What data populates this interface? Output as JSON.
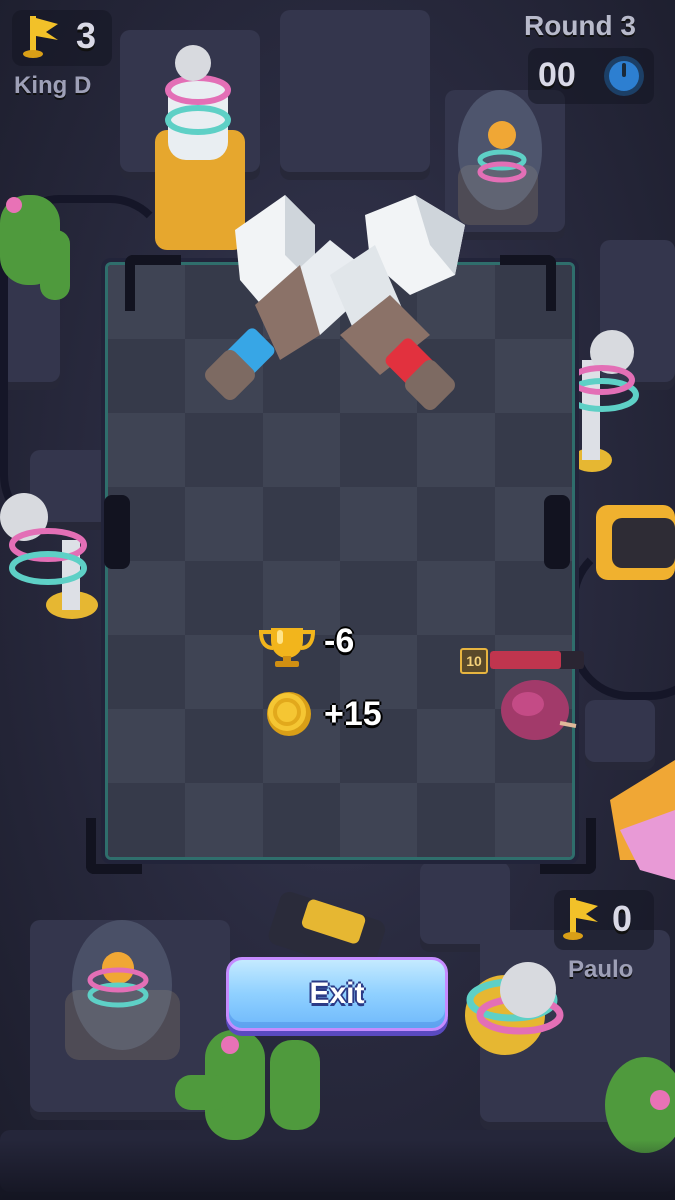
{
  "hud": {
    "player_top": {
      "name": "King D",
      "flags": "3"
    },
    "round": {
      "label": "Round 3",
      "timer": "00"
    },
    "player_bottom": {
      "name": "Paulo",
      "flags": "0"
    }
  },
  "results": {
    "trophies": "-6",
    "coins": "+15"
  },
  "enemy": {
    "level": "10",
    "health_fraction": 0.75
  },
  "exit_button": {
    "label": "Exit"
  },
  "icons": {
    "flag": "flag-icon",
    "timer": "timer-icon",
    "trophy": "trophy-icon",
    "coin": "coin-icon",
    "crossed_swords": "crossed-swords-icon"
  },
  "colors": {
    "board_light": "#3f4454",
    "board_dark": "#363a4a",
    "button_top": "#c4eaff",
    "button_bottom": "#6fb9fb",
    "trophy": "#f2b51c",
    "coin": "#f5c633",
    "health": "#c0354e"
  }
}
